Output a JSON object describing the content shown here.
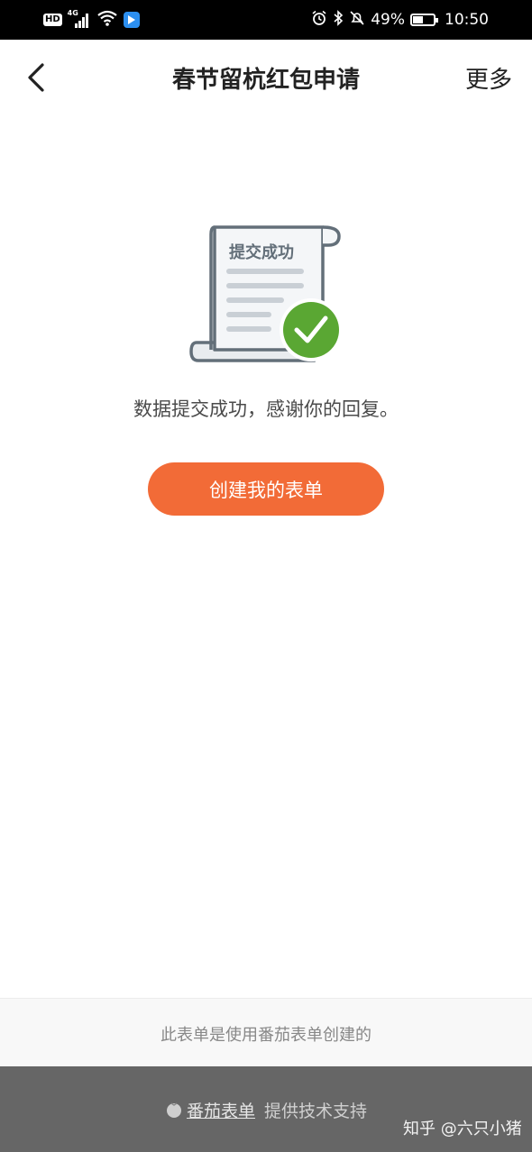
{
  "status_bar": {
    "hd": "HD",
    "network": "4G",
    "battery_percent": "49%",
    "battery_level": 0.49,
    "time": "10:50"
  },
  "nav": {
    "title": "春节留杭红包申请",
    "more_label": "更多"
  },
  "illustration": {
    "label": "提交成功"
  },
  "main": {
    "message": "数据提交成功，感谢你的回复。",
    "create_button": "创建我的表单"
  },
  "footer": {
    "note": "此表单是使用番茄表单创建的",
    "brand_name": "番茄表单",
    "brand_support": "提供技术支持",
    "watermark": "知乎 @六只小猪"
  },
  "colors": {
    "accent": "#f26b37",
    "success": "#5aa733",
    "footer_bar": "#666666"
  }
}
